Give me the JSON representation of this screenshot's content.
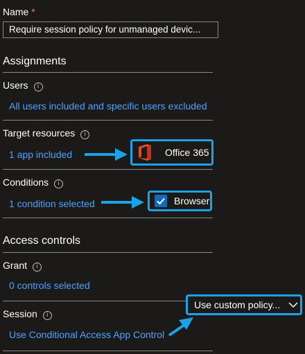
{
  "name_field": {
    "label": "Name",
    "required_mark": "*",
    "value": "Require session policy for unmanaged devic..."
  },
  "assignments": {
    "heading": "Assignments",
    "users": {
      "label": "Users",
      "value": "All users included and specific users excluded"
    },
    "target_resources": {
      "label": "Target resources",
      "value": "1 app included"
    },
    "conditions": {
      "label": "Conditions",
      "value": "1 condition selected"
    }
  },
  "access_controls": {
    "heading": "Access controls",
    "grant": {
      "label": "Grant",
      "value": "0 controls selected"
    },
    "session": {
      "label": "Session",
      "value": "Use Conditional Access App Control"
    }
  },
  "callouts": {
    "office": {
      "label": "Office 365",
      "icon": "office-365-icon"
    },
    "browser": {
      "label": "Browser",
      "icon": "checkbox-checked-icon"
    },
    "policy": {
      "label": "Use custom policy...",
      "icon": "chevron-down-icon"
    }
  },
  "colors": {
    "background": "#1b1a19",
    "link": "#4aa3ff",
    "callout_border": "#1aa3e8",
    "arrow": "#1aa3e8",
    "checkbox": "#0f6cbd",
    "office_orange": "#e8492b"
  },
  "info_glyph": "i"
}
